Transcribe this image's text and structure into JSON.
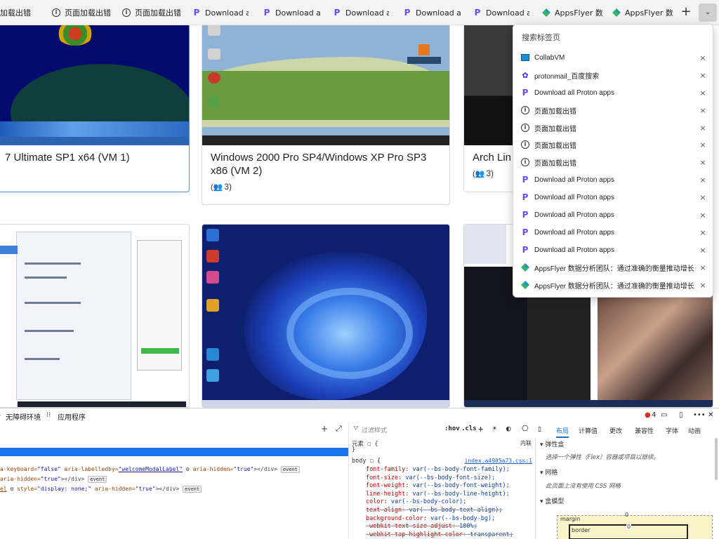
{
  "tabs": [
    {
      "icon": "none",
      "label": "加载出错"
    },
    {
      "icon": "info-icon",
      "label": "页面加载出错"
    },
    {
      "icon": "info-icon",
      "label": "页面加载出错"
    },
    {
      "icon": "proton-icon",
      "label": "Download all P"
    },
    {
      "icon": "proton-icon",
      "label": "Download all P"
    },
    {
      "icon": "proton-icon",
      "label": "Download all P"
    },
    {
      "icon": "proton-icon",
      "label": "Download all P"
    },
    {
      "icon": "proton-icon",
      "label": "Download all P"
    },
    {
      "icon": "appsflyer-icon",
      "label": "AppsFlyer 数据"
    },
    {
      "icon": "appsflyer-icon",
      "label": "AppsFlyer 数据"
    }
  ],
  "newtab_label": "+",
  "tabsearch_label": "⌄",
  "cards": [
    {
      "title": "7 Ultimate SP1 x64 (VM 1)",
      "users": ""
    },
    {
      "title": "Windows 2000 Pro SP4/Windows XP Pro SP3 x86 (VM 2)",
      "users": "3"
    },
    {
      "title": "Arch Lin",
      "users": "3"
    }
  ],
  "dropdown": {
    "search_placeholder": "搜索标签页",
    "items": [
      {
        "icon": "collabvm-icon",
        "label": "CollabVM"
      },
      {
        "icon": "baidu-icon",
        "label": "protonmail_百度搜索"
      },
      {
        "icon": "proton-icon",
        "label": "Download all Proton apps"
      },
      {
        "icon": "info-icon",
        "label": "页面加载出错"
      },
      {
        "icon": "info-icon",
        "label": "页面加载出错"
      },
      {
        "icon": "info-icon",
        "label": "页面加载出错"
      },
      {
        "icon": "info-icon",
        "label": "页面加载出错"
      },
      {
        "icon": "proton-icon",
        "label": "Download all Proton apps"
      },
      {
        "icon": "proton-icon",
        "label": "Download all Proton apps"
      },
      {
        "icon": "proton-icon",
        "label": "Download all Proton apps"
      },
      {
        "icon": "proton-icon",
        "label": "Download all Proton apps"
      },
      {
        "icon": "proton-icon",
        "label": "Download all Proton apps"
      },
      {
        "icon": "appsflyer-icon",
        "label": "AppsFlyer 数据分析团队：通过准确的衡量推动增长"
      },
      {
        "icon": "appsflyer-icon",
        "label": "AppsFlyer 数据分析团队：通过准确的衡量推动增长"
      }
    ],
    "close_glyph": "×"
  },
  "devtools": {
    "topbar": {
      "accessibility": "无障碍环境",
      "application": "应用程序",
      "error_count": "4"
    },
    "panel_tabs": [
      "布局",
      "计算值",
      "更改",
      "兼容性",
      "字体",
      "动画"
    ],
    "active_panel_tab": "布局",
    "styles": {
      "filter_placeholder": "过滤样式",
      "hov": ":hov",
      "cls": ".cls",
      "element_label": "元素",
      "element_brace": "{",
      "inline_label": "内联",
      "rule_selector": "body",
      "rule_open": "{",
      "source": "index.a4985a73.css:1",
      "declarations": [
        {
          "prop": "font-family",
          "value": "var(--bs-body-font-family);",
          "struck": false
        },
        {
          "prop": "font-size",
          "value": "var(--bs-body-font-size);",
          "struck": false
        },
        {
          "prop": "font-weight",
          "value": "var(--bs-body-font-weight);",
          "struck": false
        },
        {
          "prop": "line-height",
          "value": "var(--bs-body-line-height);",
          "struck": false
        },
        {
          "prop": "color",
          "value": "var(--bs-body-color);",
          "struck": false
        },
        {
          "prop": "text-align",
          "value": "var(--bs-body-text-align);",
          "struck": true
        },
        {
          "prop": "background-color",
          "value": "var(--bs-body-bg);",
          "struck": false
        },
        {
          "prop": "-webkit-text-size-adjust",
          "value": "100%;",
          "struck": true
        },
        {
          "prop": "-webkit-tap-highlight-color",
          "value": "transparent;",
          "struck": true
        }
      ]
    },
    "dom_lines": [
      {
        "text_a": "a-keyboard=",
        "attr_a": "\"false\"",
        "text_b": " aria-labelledby=",
        "attr_b": "\"welcomeModalLabel\"",
        "text_c": " aria-hidden=",
        "attr_c": "\"true\"",
        "text_d": "></div>",
        "pill": "event"
      },
      {
        "text_a": " aria-hidden=",
        "attr_a": "\"true\"",
        "text_b": "></div>",
        "attr_b": "",
        "text_c": "",
        "attr_c": "",
        "text_d": "",
        "pill": "event"
      },
      {
        "text_a": "el",
        "attr_a": "",
        "text_b": " style=",
        "attr_b": "\"display: none;\"",
        "text_c": " aria-hidden=",
        "attr_c": "\"true\"",
        "text_d": "></div>",
        "pill": "event"
      }
    ],
    "layout": {
      "flex_heading": "弹性盒",
      "flex_text": "选择一个弹性（Flex）容器或项目以继续。",
      "grid_heading": "网格",
      "grid_text": "此页面上没有使用 CSS 网格",
      "boxmodel_heading": "盒模型",
      "margin_label": "margin",
      "margin_value": "0",
      "border_label": "border",
      "border_value": "0"
    }
  },
  "colors": {
    "accent": "#1a73e8",
    "proton": "#6d4aff",
    "tabbar_bg": "#f3f3f3"
  }
}
